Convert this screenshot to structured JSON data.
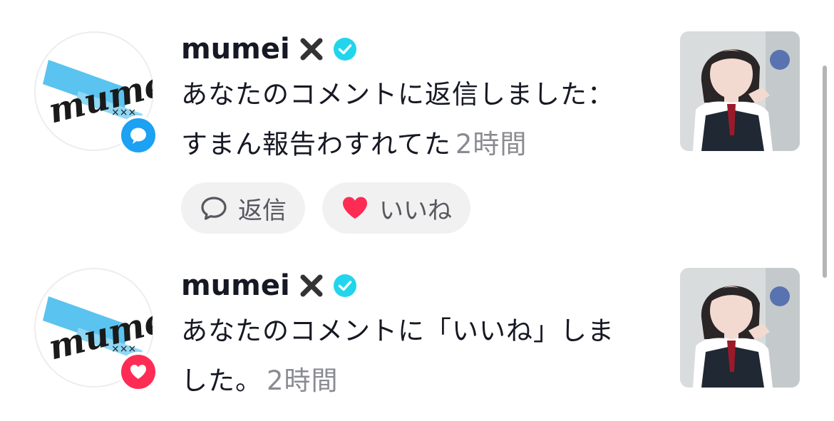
{
  "notifications": [
    {
      "username": "mumei",
      "badge_type": "comment",
      "badge_color": "#1da1f2",
      "message": "あなたのコメントに返信しました：すまん報告わすれてた",
      "time": "2時間",
      "actions": {
        "reply_label": "返信",
        "like_label": "いいね"
      }
    },
    {
      "username": "mumei",
      "badge_type": "like",
      "badge_color": "#fe2c55",
      "message": "あなたのコメントに「いいね」しました。",
      "time": "2時間"
    }
  ],
  "icons": {
    "avatar_logo_text": "mumei",
    "x_icon": "x-icon",
    "verified_icon": "verified-badge-icon",
    "reply_icon": "speech-bubble-icon",
    "like_icon": "heart-icon"
  },
  "colors": {
    "text_primary": "#161823",
    "text_secondary": "#8a8b91",
    "verified": "#20d5ec",
    "like": "#fe2c55",
    "comment_badge": "#1da1f2"
  }
}
